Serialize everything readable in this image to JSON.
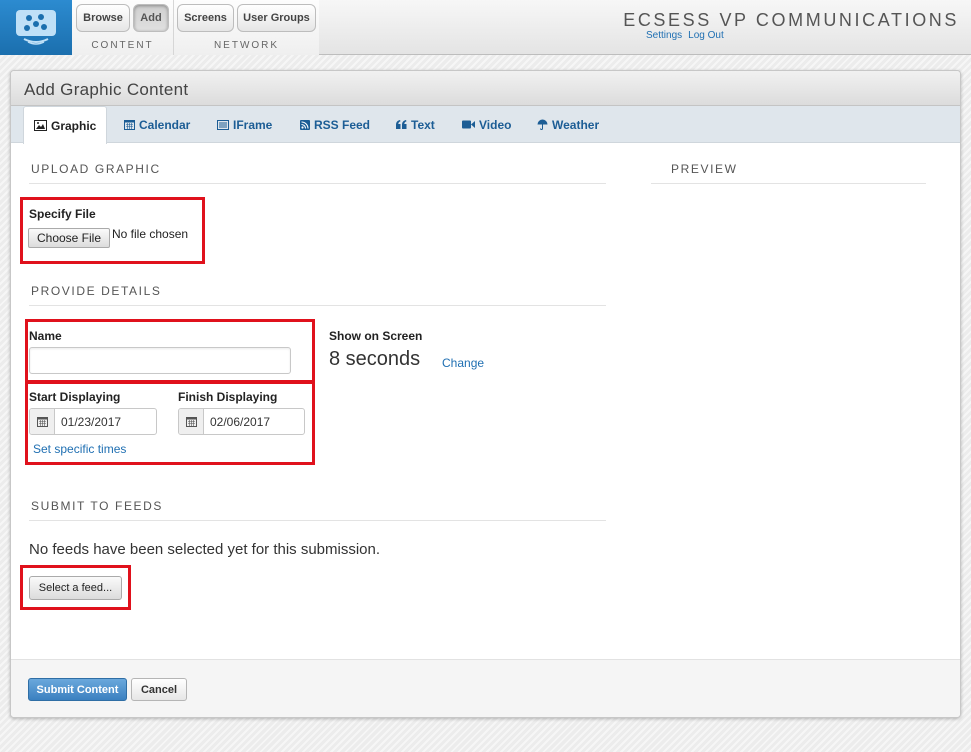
{
  "topbar": {
    "logo_icon": "display-dots-icon",
    "nav": {
      "browse": "Browse",
      "add": "Add",
      "content_caption": "CONTENT",
      "screens": "Screens",
      "user_groups": "User Groups",
      "network_caption": "NETWORK"
    },
    "brand": "ECSESS VP COMMUNICATIONS",
    "settings_link": "Settings",
    "logout_link": "Log Out"
  },
  "page": {
    "title": "Add Graphic Content",
    "tabs": [
      {
        "label": "Graphic",
        "icon": "image-icon",
        "active": true
      },
      {
        "label": "Calendar",
        "icon": "calendar-icon",
        "active": false
      },
      {
        "label": "IFrame",
        "icon": "iframe-icon",
        "active": false
      },
      {
        "label": "RSS Feed",
        "icon": "rss-icon",
        "active": false
      },
      {
        "label": "Text",
        "icon": "quote-icon",
        "active": false
      },
      {
        "label": "Video",
        "icon": "video-camera-icon",
        "active": false
      },
      {
        "label": "Weather",
        "icon": "umbrella-icon",
        "active": false
      }
    ]
  },
  "upload": {
    "heading": "UPLOAD GRAPHIC",
    "label": "Specify File",
    "choose_button": "Choose File",
    "file_status": "No file chosen"
  },
  "preview": {
    "heading": "PREVIEW"
  },
  "details": {
    "heading": "PROVIDE DETAILS",
    "name_label": "Name",
    "name_value": "",
    "show_label": "Show on Screen",
    "duration": "8 seconds",
    "change_link": "Change",
    "start_label": "Start Displaying",
    "start_date": "01/23/2017",
    "finish_label": "Finish Displaying",
    "finish_date": "02/06/2017",
    "specific_times_link": "Set specific times"
  },
  "feeds": {
    "heading": "SUBMIT TO FEEDS",
    "empty_message": "No feeds have been selected yet for this submission.",
    "select_button": "Select a feed..."
  },
  "footer": {
    "submit_button": "Submit Content",
    "cancel_button": "Cancel"
  },
  "colors": {
    "link": "#1f6fb2",
    "highlight_box": "#e0111c",
    "primary_button": "#3b80c0",
    "logo_background": "#1b6fae"
  }
}
